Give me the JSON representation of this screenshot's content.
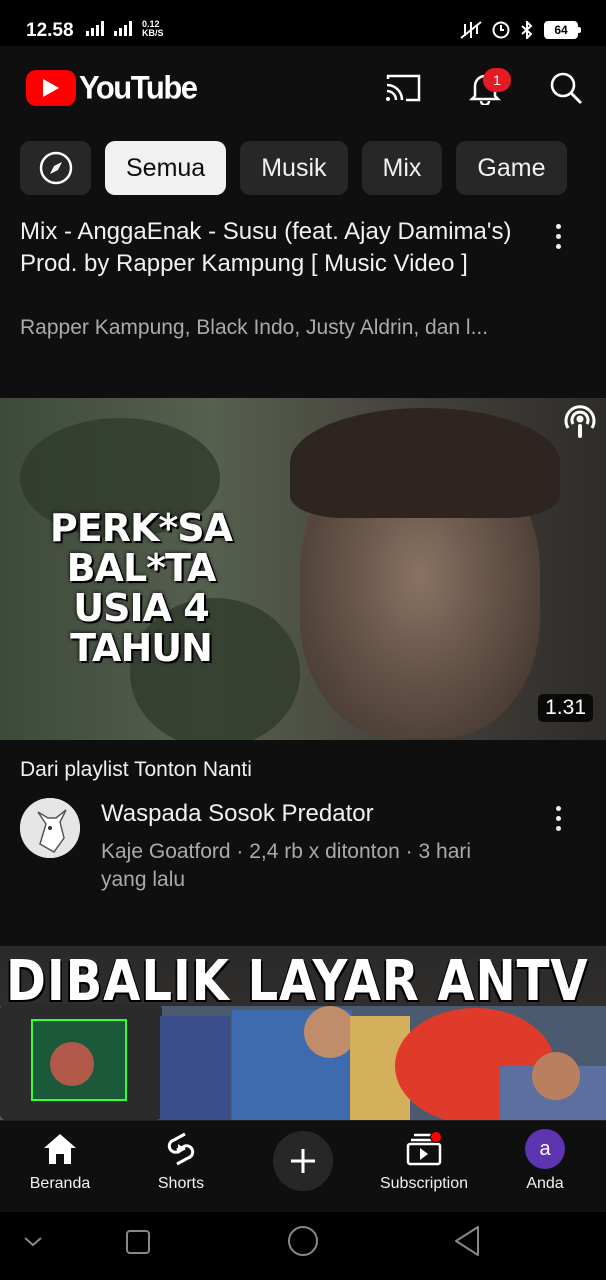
{
  "status": {
    "time": "12.58",
    "network": "4G",
    "speed_value": "0.12",
    "speed_unit": "KB/S",
    "battery": "64"
  },
  "header": {
    "logo_text": "YouTube",
    "notification_count": "1"
  },
  "chips": [
    {
      "label": "Semua",
      "active": true
    },
    {
      "label": "Musik",
      "active": false
    },
    {
      "label": "Mix",
      "active": false
    },
    {
      "label": "Game",
      "active": false
    }
  ],
  "mix": {
    "title": "Mix - AnggaEnak - Susu (feat. Ajay Damima's) Prod. by Rapper Kampung [ Music Video ]",
    "subtitle": "Rapper Kampung, Black Indo, Justy Aldrin, dan l..."
  },
  "video1": {
    "thumbnail_text": "PERK*SA BAL*TA USIA 4 TAHUN",
    "duration": "1.31",
    "playlist_note": "Dari playlist Tonton Nanti",
    "title": "Waspada Sosok Predator",
    "meta": "Kaje Goatford · 2,4 rb x ditonton · 3 hari yang lalu"
  },
  "video2": {
    "thumbnail_text": "DIBALIK LAYAR ANTV"
  },
  "bottom_nav": {
    "home": "Beranda",
    "shorts": "Shorts",
    "subscription": "Subscription",
    "you": "Anda",
    "avatar_letter": "a"
  },
  "colors": {
    "background": "#0f0f0f",
    "brand_red": "#ff0000",
    "chip_bg": "#272727",
    "avatar": "#5e35b1"
  }
}
